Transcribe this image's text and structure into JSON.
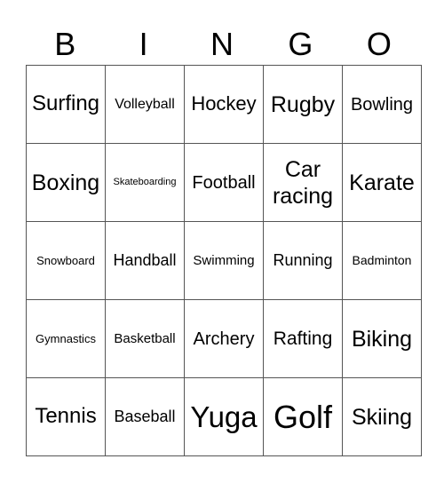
{
  "header": [
    "B",
    "I",
    "N",
    "G",
    "O"
  ],
  "cells": [
    [
      {
        "t": "Surfing",
        "s": 24
      },
      {
        "t": "Volleyball",
        "s": 16
      },
      {
        "t": "Hockey",
        "s": 22
      },
      {
        "t": "Rugby",
        "s": 25
      },
      {
        "t": "Bowling",
        "s": 20
      }
    ],
    [
      {
        "t": "Boxing",
        "s": 25
      },
      {
        "t": "Skateboarding",
        "s": 11
      },
      {
        "t": "Football",
        "s": 20
      },
      {
        "t": "Car racing",
        "s": 25
      },
      {
        "t": "Karate",
        "s": 25
      }
    ],
    [
      {
        "t": "Snowboard",
        "s": 13
      },
      {
        "t": "Handball",
        "s": 18
      },
      {
        "t": "Swimming",
        "s": 15
      },
      {
        "t": "Running",
        "s": 18
      },
      {
        "t": "Badminton",
        "s": 14
      }
    ],
    [
      {
        "t": "Gymnastics",
        "s": 13
      },
      {
        "t": "Basketball",
        "s": 15
      },
      {
        "t": "Archery",
        "s": 20
      },
      {
        "t": "Rafting",
        "s": 21
      },
      {
        "t": "Biking",
        "s": 25
      }
    ],
    [
      {
        "t": "Tennis",
        "s": 24
      },
      {
        "t": "Baseball",
        "s": 18
      },
      {
        "t": "Yuga",
        "s": 33
      },
      {
        "t": "Golf",
        "s": 36
      },
      {
        "t": "Skiing",
        "s": 25
      }
    ]
  ]
}
